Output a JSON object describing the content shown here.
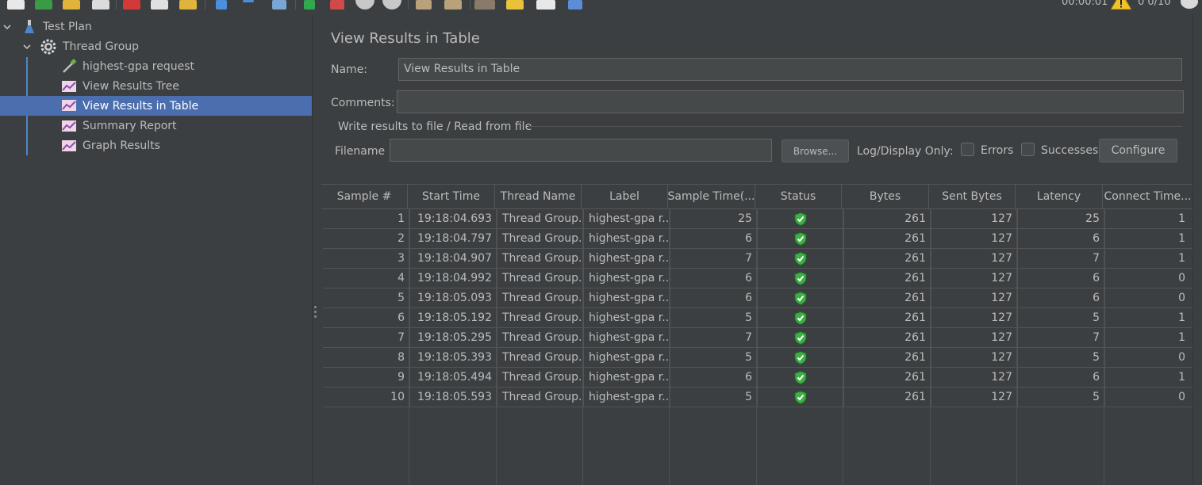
{
  "toolbar": {
    "elapsed_time": "00:00:01",
    "thread_count": "0  0/10",
    "icons": [
      "new-icon",
      "templates-icon",
      "open-icon",
      "save-icon",
      "cut-icon",
      "copy-icon",
      "paste-icon",
      "expand-icon",
      "collapse-icon",
      "toggle-icon",
      "start-icon",
      "start-no-pauses-icon",
      "stop-icon",
      "shutdown-icon",
      "clear-icon",
      "clear-all-icon",
      "search-icon",
      "reset-search-icon",
      "function-helper-icon",
      "help-icon",
      "warning-icon",
      "globe-icon"
    ]
  },
  "tree": {
    "items": [
      {
        "label": "Test Plan",
        "icon": "flask-icon"
      },
      {
        "label": "Thread Group",
        "icon": "gear-icon"
      },
      {
        "label": "highest-gpa request",
        "icon": "pipette-icon"
      },
      {
        "label": "View Results Tree",
        "icon": "graph-listener-icon"
      },
      {
        "label": "View Results in Table",
        "icon": "graph-listener-icon"
      },
      {
        "label": "Summary Report",
        "icon": "graph-listener-icon"
      },
      {
        "label": "Graph Results",
        "icon": "graph-listener-icon"
      }
    ]
  },
  "panel": {
    "title": "View Results in Table",
    "name_label": "Name:",
    "name_value": "View Results in Table",
    "comments_label": "Comments:",
    "comments_value": "",
    "file_group_title": "Write results to file / Read from file",
    "filename_label": "Filename",
    "filename_value": "",
    "browse_label": "Browse...",
    "log_display_label": "Log/Display Only:",
    "errors_label": "Errors",
    "successes_label": "Successes",
    "configure_label": "Configure",
    "errors_checked": false,
    "successes_checked": false
  },
  "table": {
    "headers": [
      "Sample #",
      "Start Time",
      "Thread Name",
      "Label",
      "Sample Time(...",
      "Status",
      "Bytes",
      "Sent Bytes",
      "Latency",
      "Connect Time..."
    ],
    "rows": [
      [
        "1",
        "19:18:04.693",
        "Thread Group...",
        "highest-gpa r...",
        "25",
        "success",
        "261",
        "127",
        "25",
        "1"
      ],
      [
        "2",
        "19:18:04.797",
        "Thread Group...",
        "highest-gpa r...",
        "6",
        "success",
        "261",
        "127",
        "6",
        "1"
      ],
      [
        "3",
        "19:18:04.907",
        "Thread Group...",
        "highest-gpa r...",
        "7",
        "success",
        "261",
        "127",
        "7",
        "1"
      ],
      [
        "4",
        "19:18:04.992",
        "Thread Group...",
        "highest-gpa r...",
        "6",
        "success",
        "261",
        "127",
        "6",
        "0"
      ],
      [
        "5",
        "19:18:05.093",
        "Thread Group...",
        "highest-gpa r...",
        "6",
        "success",
        "261",
        "127",
        "6",
        "0"
      ],
      [
        "6",
        "19:18:05.192",
        "Thread Group...",
        "highest-gpa r...",
        "5",
        "success",
        "261",
        "127",
        "5",
        "1"
      ],
      [
        "7",
        "19:18:05.295",
        "Thread Group...",
        "highest-gpa r...",
        "7",
        "success",
        "261",
        "127",
        "7",
        "1"
      ],
      [
        "8",
        "19:18:05.393",
        "Thread Group...",
        "highest-gpa r...",
        "5",
        "success",
        "261",
        "127",
        "5",
        "0"
      ],
      [
        "9",
        "19:18:05.494",
        "Thread Group...",
        "highest-gpa r...",
        "6",
        "success",
        "261",
        "127",
        "6",
        "1"
      ],
      [
        "10",
        "19:18:05.593",
        "Thread Group...",
        "highest-gpa r...",
        "5",
        "success",
        "261",
        "127",
        "5",
        "0"
      ]
    ]
  },
  "colors": {
    "background": "#3c3f41",
    "selection": "#4b6eaf",
    "success": "#3cb043",
    "text": "#bbbbbb"
  }
}
